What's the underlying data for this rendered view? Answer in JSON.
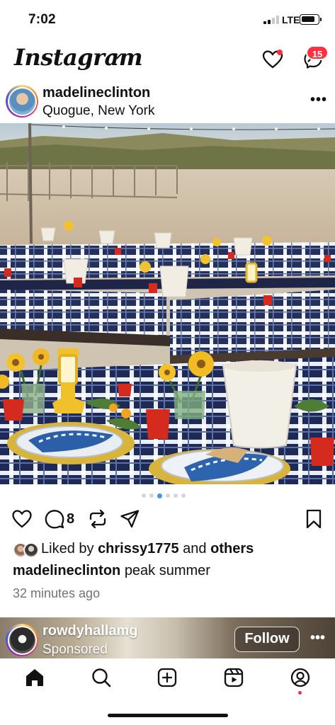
{
  "status_bar": {
    "time": "7:02",
    "network": "LTE"
  },
  "header": {
    "logo": "Instagram",
    "messages_badge": "15"
  },
  "post": {
    "username": "madelineclinton",
    "location": "Quogue, New York",
    "comment_count": "8",
    "likes": {
      "prefix": "Liked by",
      "user": "chrissy1775",
      "joiner": "and",
      "others": "others"
    },
    "caption": {
      "username": "madelineclinton",
      "text": "peak summer"
    },
    "time_ago": "32 minutes ago",
    "carousel": {
      "count": 6,
      "active_index": 2
    }
  },
  "next_post": {
    "username": "rowdyhallamg",
    "subtitle": "Sponsored",
    "follow_label": "Follow"
  },
  "icons": {
    "heart": "heart-icon",
    "messenger": "messenger-icon",
    "more": "more-icon",
    "like": "heart-icon",
    "comment": "comment-icon",
    "repost": "repost-icon",
    "share": "send-icon",
    "save": "bookmark-icon",
    "home": "home-icon",
    "search": "search-icon",
    "create": "plus-square-icon",
    "reels": "reels-icon",
    "profile": "profile-icon"
  },
  "colors": {
    "notification": "#ff3040",
    "carousel_active": "#3897f0",
    "muted_text": "#737373"
  }
}
